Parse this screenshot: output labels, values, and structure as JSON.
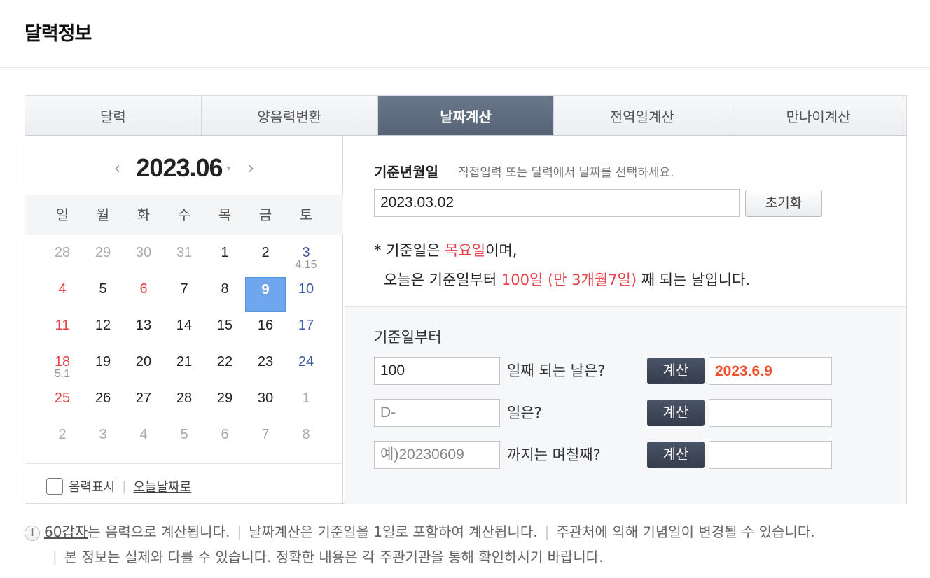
{
  "page": {
    "title": "달력정보"
  },
  "tabs": [
    {
      "label": "달력",
      "active": false
    },
    {
      "label": "양음력변환",
      "active": false
    },
    {
      "label": "날짜계산",
      "active": true
    },
    {
      "label": "전역일계산",
      "active": false
    },
    {
      "label": "만나이계산",
      "active": false
    }
  ],
  "calendar": {
    "month_label": "2023.06",
    "prev": "‹",
    "next": "›",
    "dropdown": "▾",
    "weekdays": [
      "일",
      "월",
      "화",
      "수",
      "목",
      "금",
      "토"
    ],
    "weeks": [
      [
        {
          "d": "28",
          "t": "grey"
        },
        {
          "d": "29",
          "t": "grey"
        },
        {
          "d": "30",
          "t": "grey"
        },
        {
          "d": "31",
          "t": "grey"
        },
        {
          "d": "1",
          "t": ""
        },
        {
          "d": "2",
          "t": ""
        },
        {
          "d": "3",
          "t": "sat",
          "lunar": "4.15"
        }
      ],
      [
        {
          "d": "4",
          "t": "sun"
        },
        {
          "d": "5",
          "t": ""
        },
        {
          "d": "6",
          "t": "sun"
        },
        {
          "d": "7",
          "t": ""
        },
        {
          "d": "8",
          "t": ""
        },
        {
          "d": "9",
          "t": "today"
        },
        {
          "d": "10",
          "t": "sat"
        }
      ],
      [
        {
          "d": "11",
          "t": "sun"
        },
        {
          "d": "12",
          "t": ""
        },
        {
          "d": "13",
          "t": ""
        },
        {
          "d": "14",
          "t": ""
        },
        {
          "d": "15",
          "t": ""
        },
        {
          "d": "16",
          "t": ""
        },
        {
          "d": "17",
          "t": "sat"
        }
      ],
      [
        {
          "d": "18",
          "t": "sun",
          "lunar": "5.1"
        },
        {
          "d": "19",
          "t": ""
        },
        {
          "d": "20",
          "t": ""
        },
        {
          "d": "21",
          "t": ""
        },
        {
          "d": "22",
          "t": ""
        },
        {
          "d": "23",
          "t": ""
        },
        {
          "d": "24",
          "t": "sat"
        }
      ],
      [
        {
          "d": "25",
          "t": "sun"
        },
        {
          "d": "26",
          "t": ""
        },
        {
          "d": "27",
          "t": ""
        },
        {
          "d": "28",
          "t": ""
        },
        {
          "d": "29",
          "t": ""
        },
        {
          "d": "30",
          "t": ""
        },
        {
          "d": "1",
          "t": "grey"
        }
      ],
      [
        {
          "d": "2",
          "t": "grey"
        },
        {
          "d": "3",
          "t": "grey"
        },
        {
          "d": "4",
          "t": "grey"
        },
        {
          "d": "5",
          "t": "grey"
        },
        {
          "d": "6",
          "t": "grey"
        },
        {
          "d": "7",
          "t": "grey"
        },
        {
          "d": "8",
          "t": "grey"
        }
      ]
    ],
    "lunar_toggle_label": "음력표시",
    "separator": "|",
    "today_link": "오늘날짜로"
  },
  "base": {
    "label": "기준년월일",
    "hint": "직접입력 또는 달력에서 날짜를 선택하세요.",
    "value": "2023.03.02",
    "reset_label": "초기화",
    "info_prefix": "* 기준일은 ",
    "weekday": "목요일",
    "info_suffix": "이며,",
    "line2_prefix": "오늘은 기준일부터 ",
    "elapsed": "100일 (만 3개월7일)",
    "line2_suffix": " 째 되는 날입니다."
  },
  "calc": {
    "section_label": "기준일부터",
    "button_label": "계산",
    "rows": [
      {
        "input_value": "100",
        "placeholder": "",
        "question": "일째 되는 날은?",
        "result": "2023.6.9"
      },
      {
        "input_value": "",
        "placeholder": "D-",
        "question": "일은?",
        "result": ""
      },
      {
        "input_value": "",
        "placeholder": "예)20230609",
        "question": "까지는 며칠째?",
        "result": ""
      }
    ]
  },
  "notes": {
    "icon": "i",
    "link": "60갑자",
    "n1": "는 음력으로 계산됩니다.",
    "n2": "날짜계산은 기준일을 1일로 포함하여 계산됩니다.",
    "n3": "주관처에 의해 기념일이 변경될 수 있습니다.",
    "n4": "본 정보는 실제와 다를 수 있습니다. 정확한 내용은 각 주관기관을 통해 확인하시기 바랍니다.",
    "sep": "|"
  },
  "colors": {
    "active_tab": "#5f6c80",
    "holiday": "#e8404b",
    "saturday": "#3e5aa0",
    "today_cell": "#6fa6ee",
    "result": "#f0502b",
    "calc_button": "#3d4658"
  },
  "icons": {
    "info": "info-icon",
    "prev": "chevron-left-icon",
    "next": "chevron-right-icon",
    "dropdown": "chevron-down-icon"
  }
}
